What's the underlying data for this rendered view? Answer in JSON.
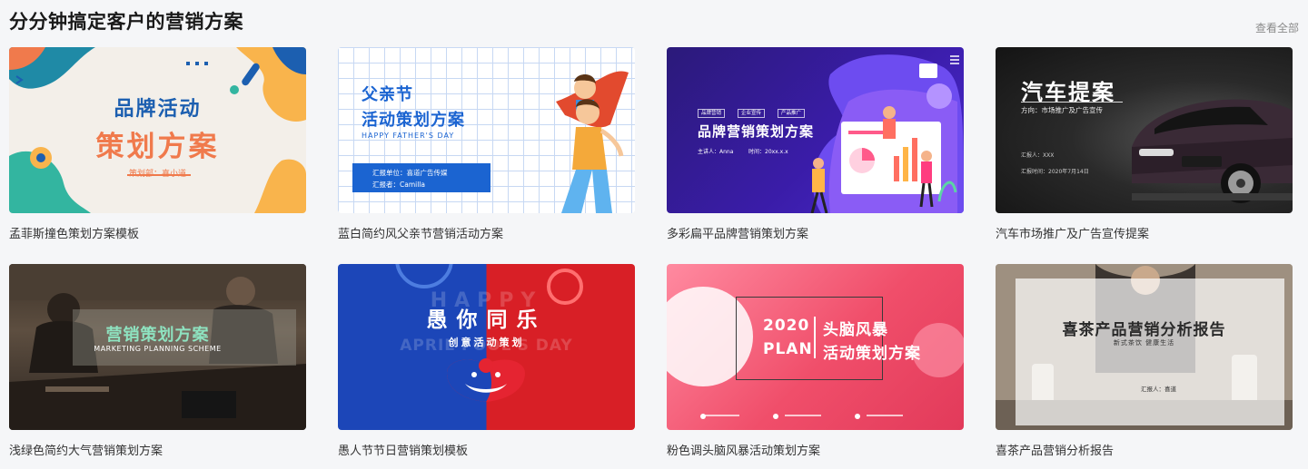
{
  "section": {
    "title": "分分钟搞定客户的营销方案",
    "view_all": "查看全部"
  },
  "cards": [
    {
      "caption": "孟菲斯撞色策划方案模板",
      "thumb": {
        "line1": "品牌活动",
        "line2": "策划方案",
        "presenter": "策划部：喜小道"
      }
    },
    {
      "caption": "蓝白简约风父亲节营销活动方案",
      "thumb": {
        "line1": "父亲节",
        "line2": "活动策划方案",
        "en": "HAPPY FATHER'S DAY",
        "unit": "汇报单位：喜道广告传媒",
        "reporter": "汇报者：Camilla"
      }
    },
    {
      "caption": "多彩扁平品牌营销策划方案",
      "thumb": {
        "tags": [
          "品牌营销",
          "企业宣传",
          "产品推广"
        ],
        "title": "品牌营销策划方案",
        "speaker": "主讲人：Anna",
        "time": "时间：20xx.x.x"
      }
    },
    {
      "caption": "汽车市场推广及广告宣传提案",
      "thumb": {
        "title": "汽车提案",
        "subtitle": "方向：市场推广及广告宣传",
        "reporter": "汇报人：XXX",
        "time": "汇报时间：2020年7月14日"
      }
    },
    {
      "caption": "浅绿色简约大气营销策划方案",
      "thumb": {
        "title": "营销策划方案",
        "en": "MARKETING PLANNING SCHEME"
      }
    },
    {
      "caption": "愚人节节日营销策划模板",
      "thumb": {
        "title": "愚你同乐",
        "subtitle": "创意活动策划",
        "bg_word": "HAPPY",
        "bg_phrase": "APRIL FOOL'S DAY"
      }
    },
    {
      "caption": "粉色调头脑风暴活动策划方案",
      "thumb": {
        "year": "2020",
        "plan": "PLAN",
        "title1": "头脑风暴",
        "title2": "活动策划方案"
      }
    },
    {
      "caption": "喜茶产品营销分析报告",
      "thumb": {
        "title": "喜茶产品营销分析报告",
        "subtitle": "新式茶饮 健康生活",
        "reporter": "汇报人：喜道"
      }
    }
  ],
  "colors": {
    "background": "#f5f6f8",
    "title": "#1a1a1a",
    "link": "#8a8a8a",
    "caption": "#333333"
  }
}
